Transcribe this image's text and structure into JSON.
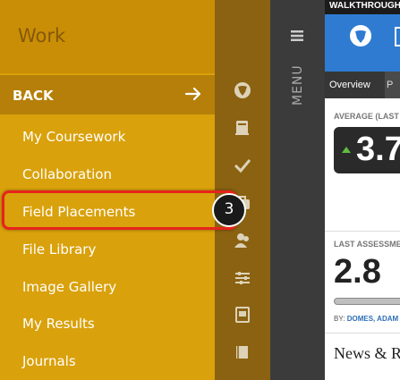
{
  "nav": {
    "title": "Work",
    "back_label": "BACK",
    "items": [
      {
        "label": "My Coursework"
      },
      {
        "label": "Collaboration"
      },
      {
        "label": "Field Placements"
      },
      {
        "label": "File Library"
      },
      {
        "label": "Image Gallery"
      },
      {
        "label": "My Results"
      },
      {
        "label": "Journals"
      }
    ],
    "highlighted_item": "Field Placements",
    "step_badge": "3"
  },
  "rail": {
    "icons": [
      "logo-icon",
      "book-icon",
      "checkmark-icon",
      "briefcase-icon",
      "users-icon",
      "sliders-icon",
      "portfolio-icon",
      "journal-icon"
    ]
  },
  "menu": {
    "label": "MENU"
  },
  "content": {
    "walkthrough": "WALKTHROUGH",
    "tabs": [
      {
        "label": "Overview"
      },
      {
        "label": "P"
      }
    ],
    "average_label": "AVERAGE (LAST",
    "average_value": "3.7",
    "last_assessment_label": "LAST ASSESSME",
    "last_assessment_value": "2.8",
    "by_prefix": "BY: ",
    "by_name": "DOMES, ADAM (",
    "news_heading": "News & R"
  },
  "colors": {
    "nav_bg": "#d9a10b",
    "back_bg": "#b57f09",
    "rail_bg": "#8a6211",
    "highlight_border": "#e6241c",
    "header_blue": "#2f7bd1"
  }
}
